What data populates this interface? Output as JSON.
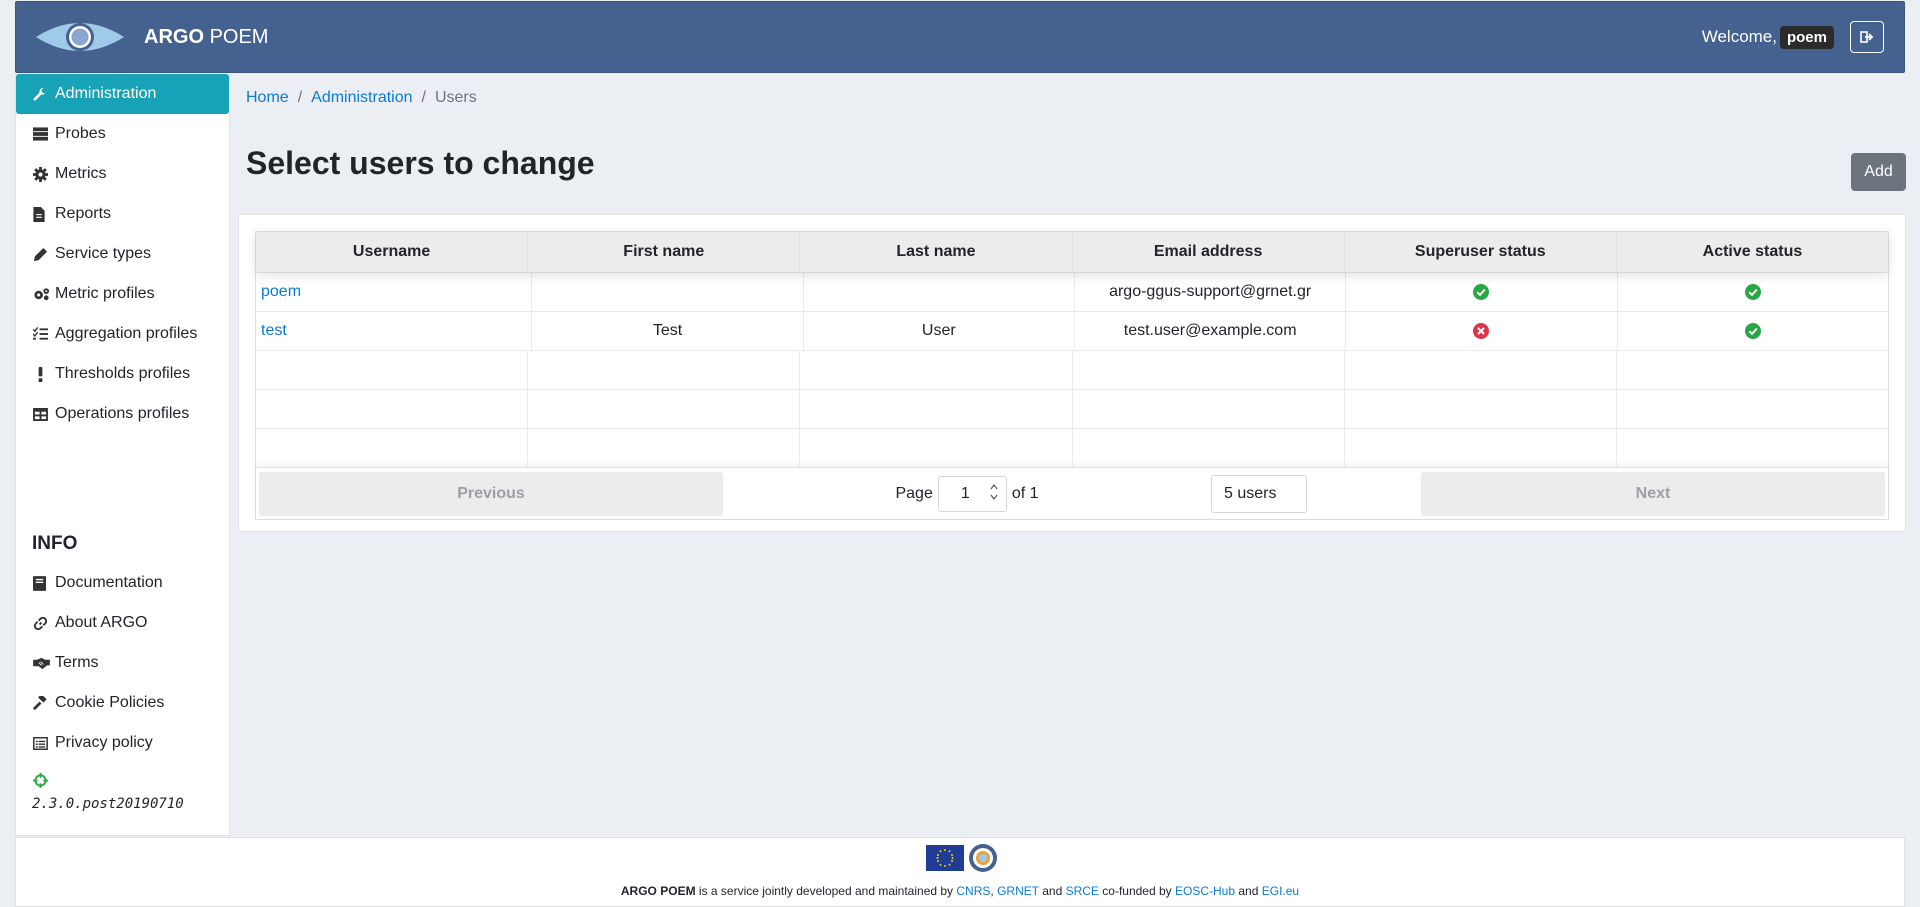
{
  "header": {
    "brand_bold": "ARGO",
    "brand_rest": "POEM",
    "welcome": "Welcome,",
    "username": "poem"
  },
  "sidebar": {
    "items": [
      {
        "label": "Administration",
        "icon": "wrench-icon",
        "active": true
      },
      {
        "label": "Probes",
        "icon": "server-icon"
      },
      {
        "label": "Metrics",
        "icon": "gear-icon"
      },
      {
        "label": "Reports",
        "icon": "file-icon"
      },
      {
        "label": "Service types",
        "icon": "pen-icon"
      },
      {
        "label": "Metric profiles",
        "icon": "cogs-icon"
      },
      {
        "label": "Aggregation profiles",
        "icon": "tasks-icon"
      },
      {
        "label": "Thresholds profiles",
        "icon": "exclamation-icon"
      },
      {
        "label": "Operations profiles",
        "icon": "table-icon"
      }
    ],
    "info_title": "INFO",
    "info_items": [
      {
        "label": "Documentation",
        "icon": "book-icon"
      },
      {
        "label": "About ARGO",
        "icon": "link-icon"
      },
      {
        "label": "Terms",
        "icon": "handshake-icon"
      },
      {
        "label": "Cookie Policies",
        "icon": "gavel-icon"
      },
      {
        "label": "Privacy policy",
        "icon": "list-alt-icon"
      }
    ],
    "version": "2.3.0.post20190710"
  },
  "breadcrumb": {
    "home": "Home",
    "admin": "Administration",
    "current": "Users",
    "separator": "/"
  },
  "page": {
    "title": "Select users to change",
    "add_label": "Add"
  },
  "table": {
    "headers": [
      "Username",
      "First name",
      "Last name",
      "Email address",
      "Superuser status",
      "Active status"
    ],
    "rows": [
      {
        "username": "poem",
        "first": "",
        "last": "",
        "email": "argo-ggus-support@grnet.gr",
        "superuser": true,
        "active": true
      },
      {
        "username": "test",
        "first": "Test",
        "last": "User",
        "email": "test.user@example.com",
        "superuser": false,
        "active": true
      }
    ]
  },
  "pagination": {
    "previous": "Previous",
    "next": "Next",
    "page_label": "Page",
    "page_value": "1",
    "of_label": "of 1",
    "page_size": "5 users"
  },
  "footer": {
    "brand": "ARGO POEM",
    "text1": " is a service jointly developed and maintained by ",
    "cnrs": "CNRS",
    "comma": ",",
    "grnet": "GRNET",
    "and1": " and ",
    "srce": "SRCE",
    "text2": " co-funded by ",
    "eosc": "EOSC-Hub",
    "and2": " and ",
    "egi": "EGI.eu"
  },
  "colors": {
    "header": "#44618f",
    "active_nav": "#17a2b8",
    "link": "#0a7bd6",
    "success": "#28a745",
    "danger": "#dc3545"
  }
}
